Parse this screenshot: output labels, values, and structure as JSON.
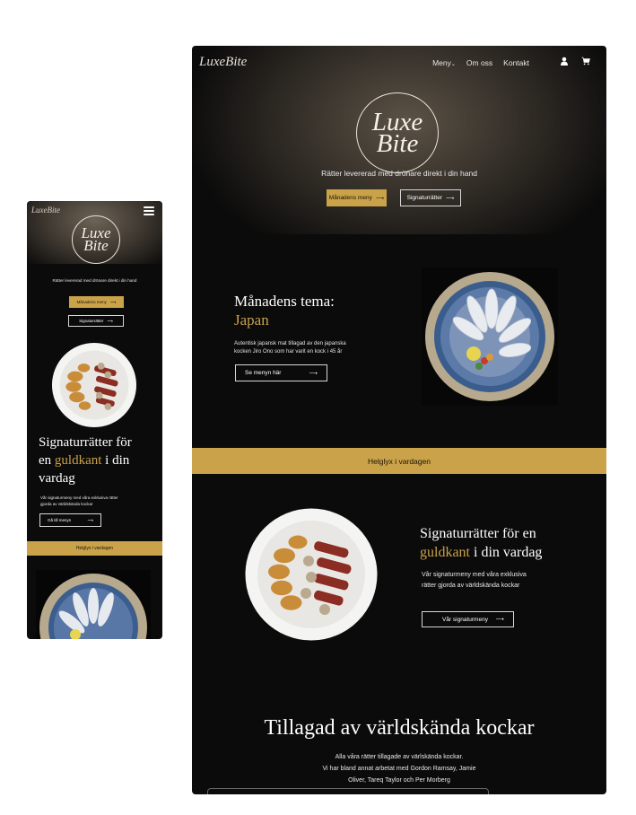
{
  "brand": {
    "name": "LuxeBite",
    "logo_line1": "Luxe",
    "logo_line2": "Bite"
  },
  "tagline": "Rätter levererad med drönare direkt i din hand",
  "colors": {
    "accent": "#c9a24a",
    "background": "#0b0b0b",
    "text": "#ffffff"
  },
  "mobile": {
    "tagline": "Rätter levererad med drönare direkt i din hand",
    "buttons": {
      "monthly": "Månadens meny",
      "signature": "Signaturrätter",
      "go_menu": "Gå till menyn"
    },
    "heading": {
      "line1": "Signaturrätter för",
      "line2_pre": "en ",
      "line2_gold": "guldkant",
      "line2_post": " i din",
      "line3": "vardag"
    },
    "description": "Vår signaturmeny med våra exklusiva rätter gjorda av världskända kockar",
    "band": "Helglyx i vardagen",
    "icons": {
      "menu": "hamburger-icon",
      "arrow": "arrow-right-icon"
    }
  },
  "desktop": {
    "nav": {
      "menu": "Meny",
      "about": "Om oss",
      "contact": "Kontakt"
    },
    "icons": {
      "user": "user-icon",
      "cart": "cart-icon",
      "arrow": "arrow-right-icon",
      "chevron": "chevron-down-icon"
    },
    "hero": {
      "tagline": "Rätter levererad med drönare direkt i din hand",
      "btn_monthly": "Månadens meny",
      "btn_signature": "Signaturrätter"
    },
    "theme": {
      "title": "Månadens tema:",
      "subtitle": "Japan",
      "description": "Autentisk japansk mat tillagad av den japanska kocken Jiro Ono som har varit en kock i 45 år",
      "button": "Se menyn här"
    },
    "band": "Helglyx i vardagen",
    "signature": {
      "title_line1": "Signaturrätter för en",
      "title_gold": "guldkant",
      "title_post": " i din vardag",
      "description": "Vår signaturmeny med våra exklusiva rätter gjorda av världskända kockar",
      "button": "Vår signaturmeny"
    },
    "chefs": {
      "title": "Tillagad av världskända kockar",
      "line1": "Alla våra rätter tillagade av värlskända kockar.",
      "line2": "Vi har bland annat arbetat med Gordon Ramsay, Jamie",
      "line3": "Oliver, Tareq Taylor och Per Morberg"
    }
  }
}
